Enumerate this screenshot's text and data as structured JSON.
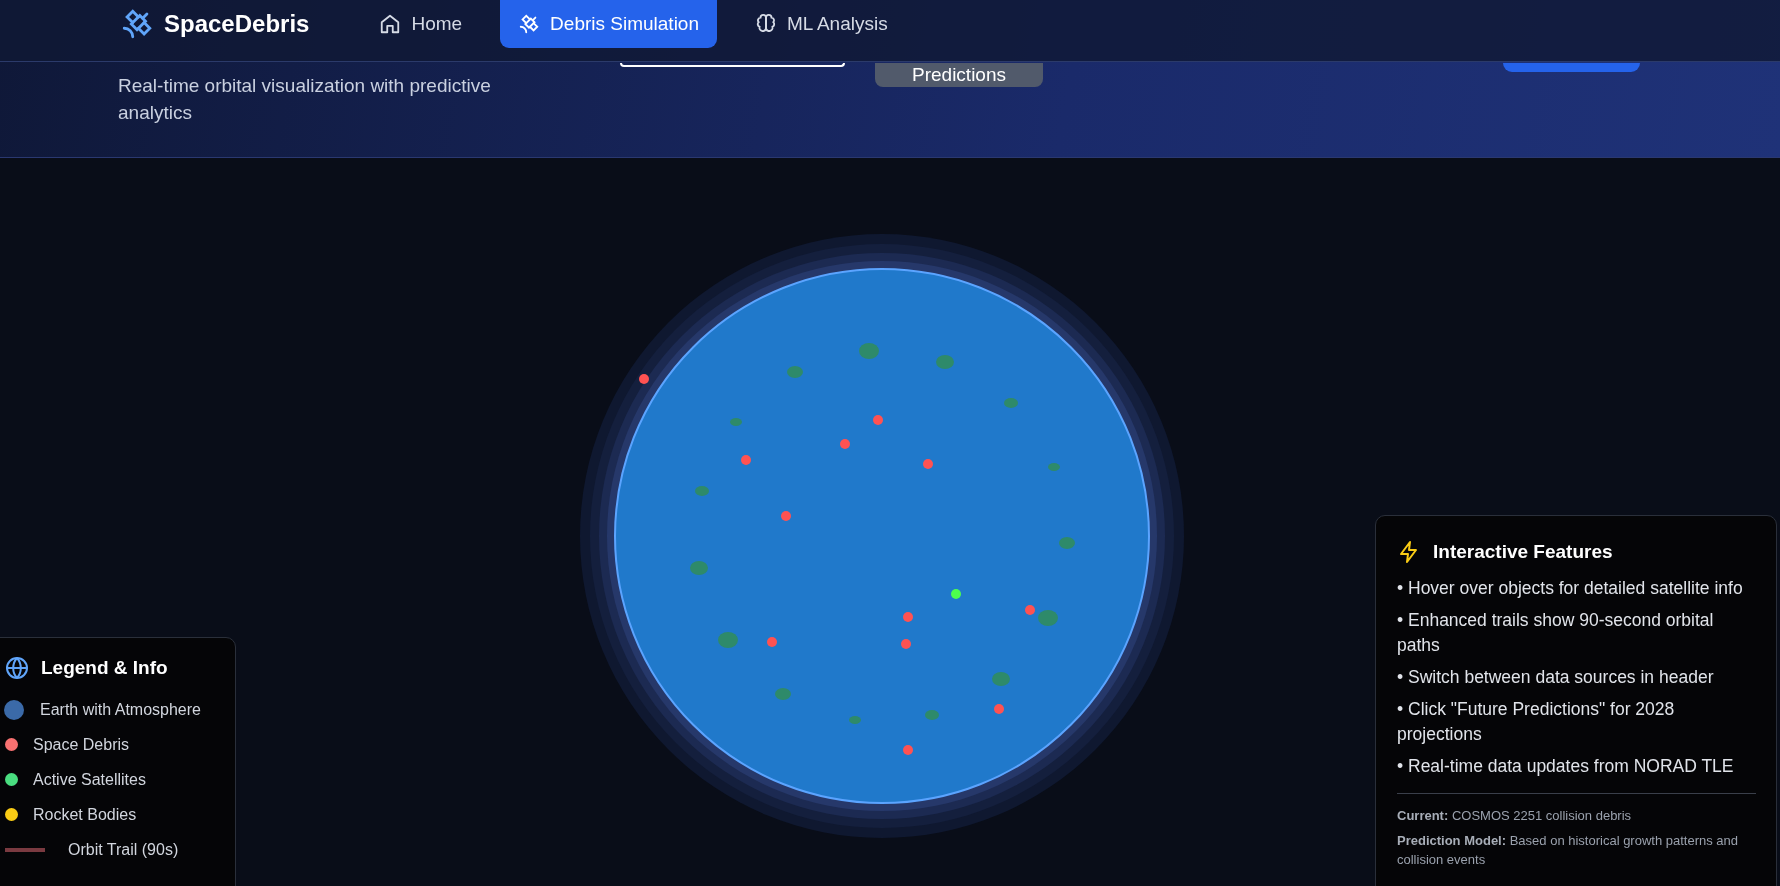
{
  "nav": {
    "brand": "SpaceDebris",
    "tabs": [
      {
        "label": "Home",
        "kind": "home",
        "selected": false
      },
      {
        "label": "Debris Simulation",
        "kind": "satellite",
        "selected": true
      },
      {
        "label": "ML Analysis",
        "kind": "brain",
        "selected": false
      }
    ]
  },
  "header": {
    "subtitle": "Real-time orbital visualization with predictive analytics",
    "predictions_button": "Predictions"
  },
  "legend": {
    "title": "Legend & Info",
    "items": [
      {
        "label": "Earth with Atmosphere",
        "kind": "large-dot",
        "color": "#3b6aa8"
      },
      {
        "label": "Space Debris",
        "kind": "dot",
        "color": "#f87171"
      },
      {
        "label": "Active Satellites",
        "kind": "dot",
        "color": "#4ade80"
      },
      {
        "label": "Rocket Bodies",
        "kind": "dot",
        "color": "#facc15"
      },
      {
        "label": "Orbit Trail (90s)",
        "kind": "trail",
        "color": "#7a3a40"
      }
    ]
  },
  "features": {
    "title": "Interactive Features",
    "items": [
      "• Hover over objects for detailed satellite info",
      "• Enhanced trails show 90-second orbital paths",
      "• Switch between data sources in header",
      "• Click \"Future Predictions\" for 2028 projections",
      "• Real-time data updates from NORAD TLE"
    ],
    "notes": [
      "**Current:** COSMOS 2251 collision debris",
      "**Prediction Model:** Based on historical growth patterns and collision events"
    ]
  }
}
